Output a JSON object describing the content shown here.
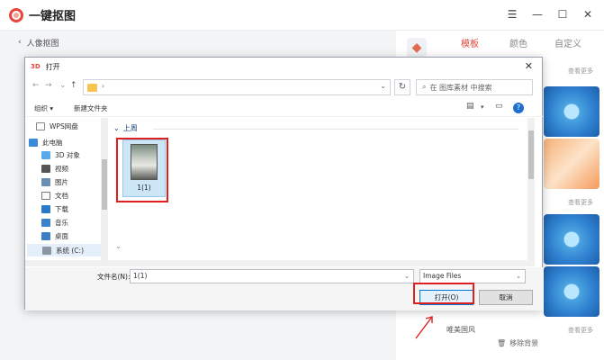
{
  "app": {
    "title": "一键抠图",
    "back_label": "人像抠图"
  },
  "right_panel": {
    "tabs": [
      "模板",
      "颜色",
      "自定义"
    ],
    "see_more": "查看更多",
    "section_label": "唯美国风",
    "remove_bg_label": "移除背景",
    "accent": "#e8453c"
  },
  "dialog": {
    "title": "打开",
    "icon_text": "3D",
    "search_placeholder": "在 图库素材 中搜索",
    "toolbar": {
      "organize": "组织 ▾",
      "new_folder": "新建文件夹"
    },
    "nav_pane": [
      {
        "label": "WPS网盘",
        "icon": "cloud-doc-icon"
      },
      {
        "label": "此电脑",
        "icon": "computer-icon"
      },
      {
        "label": "3D 对象",
        "icon": "cube-icon"
      },
      {
        "label": "视频",
        "icon": "video-icon"
      },
      {
        "label": "图片",
        "icon": "picture-icon"
      },
      {
        "label": "文档",
        "icon": "document-icon"
      },
      {
        "label": "下载",
        "icon": "download-icon"
      },
      {
        "label": "音乐",
        "icon": "music-icon"
      },
      {
        "label": "桌面",
        "icon": "desktop-icon"
      },
      {
        "label": "系统 (C:)",
        "icon": "drive-icon"
      }
    ],
    "group_header": "上周",
    "files": [
      {
        "name": "1(1)"
      }
    ],
    "filename_label": "文件名(N):",
    "filename_value": "1(1)",
    "filetype_value": "Image Files",
    "open_button": "打开(O)",
    "cancel_button": "取消"
  }
}
